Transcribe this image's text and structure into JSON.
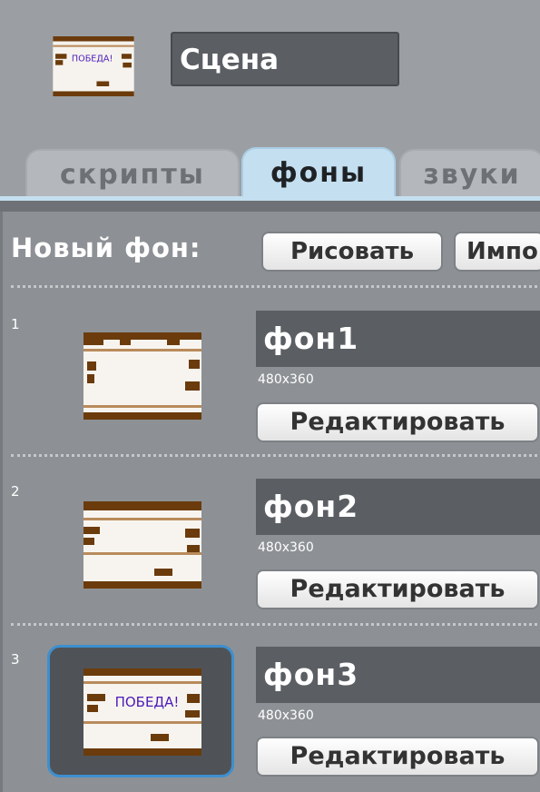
{
  "sprite": {
    "name": "Сцена",
    "thumbnail_text": "ПОБЕДА!"
  },
  "tabs": [
    {
      "label": "скрипты",
      "active": false
    },
    {
      "label": "фоны",
      "active": true
    },
    {
      "label": "звуки",
      "active": false
    }
  ],
  "new_backdrop": {
    "label": "Новый фон:",
    "paint_label": "Рисовать",
    "import_label": "Импо"
  },
  "backdrops": [
    {
      "number": "1",
      "name": "фон1",
      "size": "480x360",
      "edit_label": "Редактировать",
      "selected": false,
      "text": ""
    },
    {
      "number": "2",
      "name": "фон2",
      "size": "480x360",
      "edit_label": "Редактировать",
      "selected": false,
      "text": ""
    },
    {
      "number": "3",
      "name": "фон3",
      "size": "480x360",
      "edit_label": "Редактировать",
      "selected": true,
      "text": "ПОБЕДА!"
    }
  ],
  "colors": {
    "panel": "#8d9195",
    "active_tab": "#c4dff0",
    "selection": "#3e8fcf",
    "brick": "#6b3b0c",
    "victory_text": "#4b1bb8"
  }
}
